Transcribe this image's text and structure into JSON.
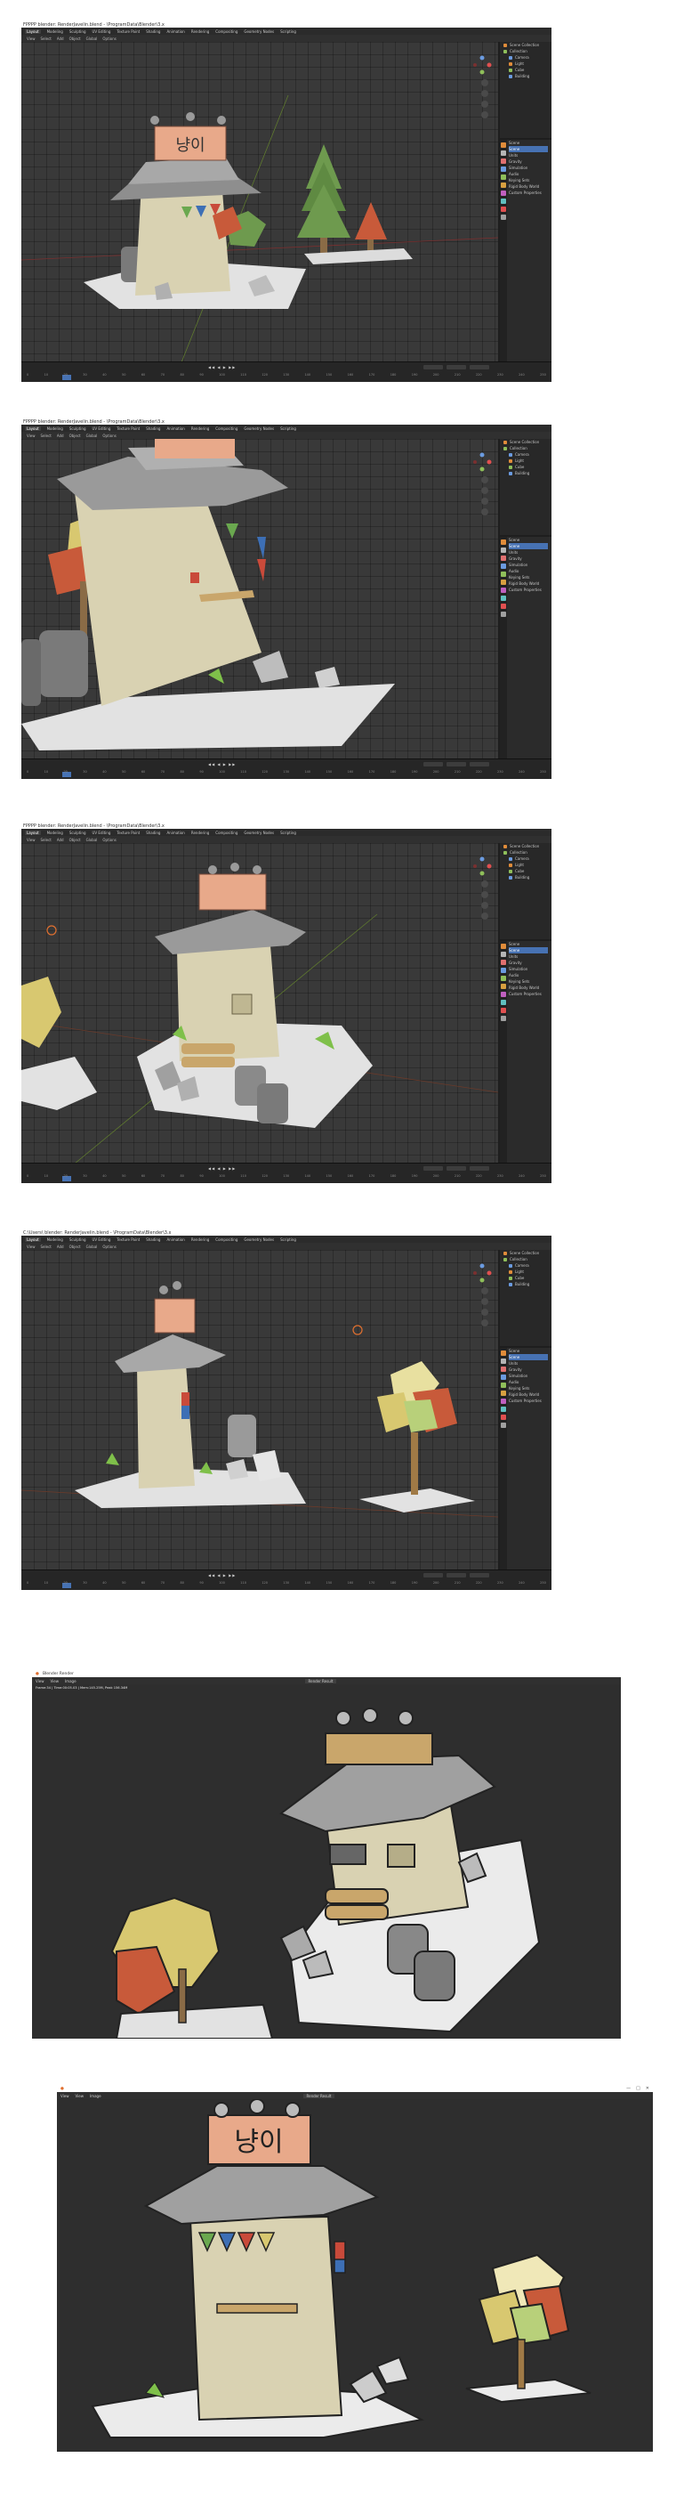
{
  "captions": [
    "FPPPP blender: RenderJavelin.blend - \\ProgramData\\Blender\\3.x",
    "FPPPP blender: RenderJavelin.blend - \\ProgramData\\Blender\\3.x",
    "FPPPP blender: RenderJavelin.blend - \\ProgramData\\Blender\\3.x",
    "C:\\Users\\ blender: RenderJavelin.blend - \\ProgramData\\Blender\\3.x"
  ],
  "menu": [
    "Layout",
    "Modeling",
    "Sculpting",
    "UV Editing",
    "Texture Paint",
    "Shading",
    "Animation",
    "Rendering",
    "Compositing",
    "Geometry Nodes",
    "Scripting"
  ],
  "view_header": [
    "View",
    "Select",
    "Add",
    "Object",
    "Global",
    "Options"
  ],
  "outliner": [
    "Scene Collection",
    "Collection",
    "Camera",
    "Light",
    "Cube",
    "Building"
  ],
  "properties": [
    "Scene",
    "Scene",
    "Units",
    "Gravity",
    "Simulation",
    "Audio",
    "Keying Sets",
    "Rigid Body World",
    "Custom Properties"
  ],
  "timeline": {
    "controls": "◀◀  ◀  ▶  ▶▶",
    "frames": [
      "0",
      "10",
      "20",
      "30",
      "40",
      "50",
      "60",
      "70",
      "80",
      "90",
      "100",
      "110",
      "120",
      "130",
      "140",
      "150",
      "160",
      "170",
      "180",
      "190",
      "200",
      "210",
      "220",
      "230",
      "240",
      "250"
    ]
  },
  "render_window": {
    "title": "Blender Render",
    "menu": [
      "View",
      "View",
      "Image"
    ],
    "slot": "Render Result",
    "info": "Frame:34 | Time:00:05.03 | Mem:145.25M, Peak 156.34M",
    "controls": [
      "—",
      "□",
      "✕"
    ]
  },
  "signboard_text": "냥이",
  "colors": {
    "roof": "#9a9a9a",
    "wall": "#d9d2b2",
    "sign": "#e8a98a",
    "tree_green": "#6e9a4e",
    "tree_red": "#c85a3a",
    "tree_yellow": "#d8c870",
    "accent": "#4772b3"
  }
}
